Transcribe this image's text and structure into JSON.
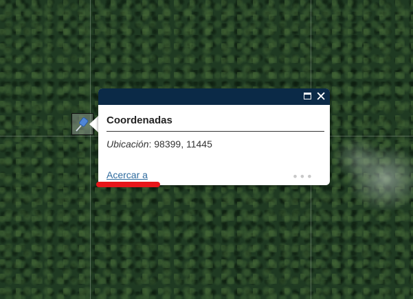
{
  "popup": {
    "title": "Coordenadas",
    "field_label": "Ubicación",
    "field_separator": ": ",
    "field_value": "98399, 11445",
    "zoom_link": "Acercar a",
    "close_glyph": "✕",
    "more_glyph": "•••",
    "header_color": "#0b2a47"
  },
  "icons": {
    "marker": "pushpin-icon",
    "maximize": "maximize-icon",
    "close": "close-icon",
    "more": "more-options-icon"
  },
  "colors": {
    "link": "#2f6b9e",
    "highlight": "#e8161a"
  }
}
